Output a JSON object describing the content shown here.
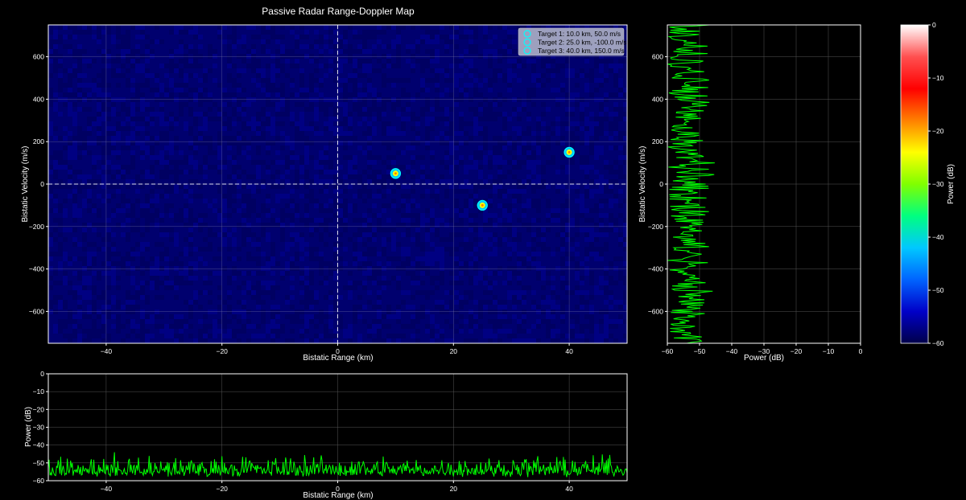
{
  "chart_data": [
    {
      "id": "range_doppler_map",
      "type": "heatmap",
      "title": "Passive Radar Range-Doppler Map",
      "xlabel": "Bistatic Range (km)",
      "ylabel": "Bistatic Velocity (m/s)",
      "xlim": [
        -50,
        50
      ],
      "ylim": [
        -750,
        750
      ],
      "xticks": [
        -40,
        -20,
        0,
        20,
        40
      ],
      "yticks": [
        -600,
        -400,
        -200,
        0,
        200,
        400,
        600
      ],
      "grid": true,
      "background_level_db": [
        -60,
        -50
      ],
      "reference_lines": [
        {
          "axis": "x",
          "value": 0,
          "style": "dashed"
        },
        {
          "axis": "y",
          "value": 0,
          "style": "dashed"
        }
      ],
      "targets": [
        {
          "label": "Target 1: 10.0 km, 50.0 m/s",
          "range_km": 10.0,
          "velocity_ms": 50.0
        },
        {
          "label": "Target 2: 25.0 km, -100.0 m/s",
          "range_km": 25.0,
          "velocity_ms": -100.0
        },
        {
          "label": "Target 3: 40.0 km, 150.0 m/s",
          "range_km": 40.0,
          "velocity_ms": 150.0
        }
      ],
      "legend_position": "top-right",
      "marker_color": "#00ffff"
    },
    {
      "id": "doppler_profile",
      "type": "line",
      "xlabel": "Power (dB)",
      "ylabel": "Bistatic Velocity (m/s)",
      "xlim": [
        -60,
        0
      ],
      "ylim": [
        -750,
        750
      ],
      "xticks": [
        -60,
        -50,
        -40,
        -30,
        -20,
        -10,
        0
      ],
      "yticks": [
        -600,
        -400,
        -200,
        0,
        200,
        400,
        600
      ],
      "grid": true,
      "line_color": "#00ff00",
      "noise_range_db": [
        -60,
        -45
      ]
    },
    {
      "id": "range_profile",
      "type": "line",
      "xlabel": "Bistatic Range (km)",
      "ylabel": "Power (dB)",
      "xlim": [
        -50,
        50
      ],
      "ylim": [
        -60,
        0
      ],
      "xticks": [
        -40,
        -20,
        0,
        20,
        40
      ],
      "yticks": [
        -60,
        -50,
        -40,
        -30,
        -20,
        -10,
        0
      ],
      "grid": true,
      "line_color": "#00ff00",
      "noise_range_db": [
        -60,
        -43
      ]
    },
    {
      "id": "colorbar",
      "type": "colorbar",
      "label": "Power (dB)",
      "range": [
        -60,
        0
      ],
      "ticks": [
        0,
        -10,
        -20,
        -30,
        -40,
        -50,
        -60
      ],
      "colormap": [
        "#00004a",
        "#0000c8",
        "#0064ff",
        "#00c8ff",
        "#00ff80",
        "#80ff00",
        "#ffff00",
        "#ff8000",
        "#ff0000",
        "#ff5050",
        "#ffffff"
      ]
    }
  ]
}
